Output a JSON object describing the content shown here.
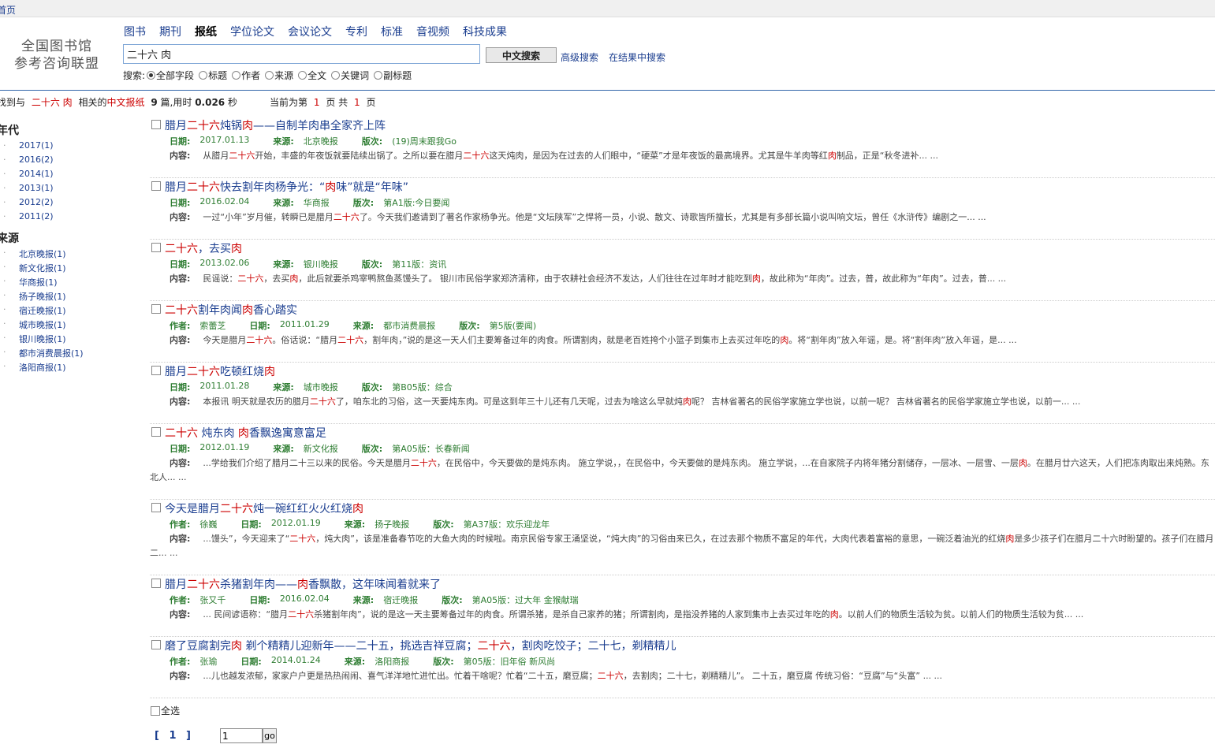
{
  "topbar": {
    "home": "首页"
  },
  "logo": {
    "line1": "全国图书馆",
    "line2": "参考咨询联盟"
  },
  "nav": [
    {
      "label": "图书",
      "active": false
    },
    {
      "label": "期刊",
      "active": false
    },
    {
      "label": "报纸",
      "active": true
    },
    {
      "label": "学位论文",
      "active": false
    },
    {
      "label": "会议论文",
      "active": false
    },
    {
      "label": "专利",
      "active": false
    },
    {
      "label": "标准",
      "active": false
    },
    {
      "label": "音视频",
      "active": false
    },
    {
      "label": "科技成果",
      "active": false
    }
  ],
  "search": {
    "value": "二十六 肉",
    "button": "中文搜索",
    "advanced": "高级搜索",
    "within": "在结果中搜索",
    "fields_label": "搜索:",
    "fields": [
      "全部字段",
      "标题",
      "作者",
      "来源",
      "全文",
      "关键词",
      "副标题"
    ],
    "selected_field": "全部字段"
  },
  "stats": {
    "prefix": "找到与",
    "query": "二十六 肉",
    "mid": "相关的",
    "type": "中文报纸",
    "count": "9",
    "unit": "篇,用时",
    "time": "0.026",
    "sec": "秒",
    "page_prefix": "当前为第",
    "current_page": "1",
    "page_mid": "页 共",
    "total_pages": "1",
    "page_suffix": "页"
  },
  "sidebar": {
    "year_heading": "年代",
    "years": [
      "2017(1)",
      "2016(2)",
      "2014(1)",
      "2013(1)",
      "2012(2)",
      "2011(2)"
    ],
    "source_heading": "来源",
    "sources": [
      "北京晚报(1)",
      "新文化报(1)",
      "华商报(1)",
      "扬子晚报(1)",
      "宿迁晚报(1)",
      "城市晚报(1)",
      "银川晚报(1)",
      "都市消费晨报(1)",
      "洛阳商报(1)"
    ]
  },
  "labels": {
    "author": "作者:",
    "date": "日期:",
    "source": "来源:",
    "edition": "版次:",
    "content": "内容:",
    "select_all": "全选",
    "go": "go",
    "pager": "[ 1 ]",
    "page_input": "1"
  },
  "results": [
    {
      "title": [
        [
          "腊月",
          0
        ],
        [
          "二十六",
          1
        ],
        [
          "炖锅",
          0
        ],
        [
          "肉",
          1
        ],
        [
          "——自制羊肉串全家齐上阵",
          0
        ]
      ],
      "author": "",
      "date": "2017.01.13",
      "source": "北京晚报",
      "edition": "(19)周末跟我Go",
      "content": [
        [
          "从腊月",
          0
        ],
        [
          "二十六",
          1
        ],
        [
          "开始，丰盛的年夜饭就要陆续出锅了。之所以要在腊月",
          0
        ],
        [
          "二十六",
          1
        ],
        [
          "这天炖肉，是因为在过去的人们眼中，“硬菜”才是年夜饭的最高境界。尤其是牛羊肉等红",
          0
        ],
        [
          "肉",
          1
        ],
        [
          "制品，正是“秋冬进补... ...",
          0
        ]
      ]
    },
    {
      "title": [
        [
          "腊月",
          0
        ],
        [
          "二十六",
          1
        ],
        [
          "快去割年肉杨争光：“",
          0
        ],
        [
          "肉",
          1
        ],
        [
          "味”就是“年味”",
          0
        ]
      ],
      "author": "",
      "date": "2016.02.04",
      "source": "华商报",
      "edition": "第A1版:今日要闻",
      "content": [
        [
          "一过“小年”岁月催，转瞬已是腊月",
          0
        ],
        [
          "二十六",
          1
        ],
        [
          "了。今天我们邀请到了著名作家杨争光。他是“文坛陕军”之悍将一员，小说、散文、诗歌皆所擅长，尤其是有多部长篇小说叫响文坛，曾任《水浒传》编剧之一... ...",
          0
        ]
      ]
    },
    {
      "title": [
        [
          "二十六",
          1
        ],
        [
          "，去买",
          0
        ],
        [
          "肉",
          1
        ]
      ],
      "author": "",
      "date": "2013.02.06",
      "source": "银川晚报",
      "edition": "第11版：资讯",
      "content": [
        [
          "民谣说：",
          0
        ],
        [
          "二十六",
          1
        ],
        [
          "，去买",
          0
        ],
        [
          "肉",
          1
        ],
        [
          "，此后就要杀鸡宰鸭熬鱼蒸馒头了。 银川市民俗学家郑济清称，由于农耕社会经济不发达，人们往往在过年时才能吃到",
          0
        ],
        [
          "肉",
          1
        ],
        [
          "，故此称为“年肉”。过去，普，故此称为“年肉”。过去，普... ...",
          0
        ]
      ]
    },
    {
      "title": [
        [
          "二十六",
          1
        ],
        [
          "割年肉闻",
          0
        ],
        [
          "肉",
          1
        ],
        [
          "香心踏实",
          0
        ]
      ],
      "author": "索蕾芝",
      "date": "2011.01.29",
      "source": "都市消费晨报",
      "edition": "第5版(要闻)",
      "content": [
        [
          "今天是腊月",
          0
        ],
        [
          "二十六",
          1
        ],
        [
          "。俗话说：“腊月",
          0
        ],
        [
          "二十六",
          1
        ],
        [
          "，割年肉，”说的是这一天人们主要筹备过年的肉食。所谓割肉，就是老百姓挎个小篮子到集市上去买过年吃的",
          0
        ],
        [
          "肉",
          1
        ],
        [
          "。将“割年肉”放入年谣，是。将“割年肉”放入年谣，是... ...",
          0
        ]
      ]
    },
    {
      "title": [
        [
          "腊月",
          0
        ],
        [
          "二十六",
          1
        ],
        [
          "吃顿红烧",
          0
        ],
        [
          "肉",
          1
        ]
      ],
      "author": "",
      "date": "2011.01.28",
      "source": "城市晚报",
      "edition": "第B05版：综合",
      "content": [
        [
          "本报讯 明天就是农历的腊月",
          0
        ],
        [
          "二十六",
          1
        ],
        [
          "了，咱东北的习俗，这一天要炖东肉。可是这到年三十儿还有几天呢，过去为啥这么早就炖",
          0
        ],
        [
          "肉",
          1
        ],
        [
          "呢？ 吉林省著名的民俗学家施立学也说，以前一呢？ 吉林省著名的民俗学家施立学也说，以前一... ...",
          0
        ]
      ]
    },
    {
      "title": [
        [
          "二十六",
          1
        ],
        [
          " 炖东肉 ",
          0
        ],
        [
          "肉",
          1
        ],
        [
          "香飘逸寓意富足",
          0
        ]
      ],
      "author": "",
      "date": "2012.01.19",
      "source": "新文化报",
      "edition": "第A05版：长春新闻",
      "content": [
        [
          "...学给我们介绍了腊月二十三以来的民俗。今天是腊月",
          0
        ],
        [
          "二十六",
          1
        ],
        [
          "，在民俗中，今天要做的是炖东肉。 施立学说，，在民俗中，今天要做的是炖东肉。 施立学说，...在自家院子内将年猪分割储存，一层冰、一层雪、一层",
          0
        ],
        [
          "肉",
          1
        ],
        [
          "。在腊月廿六这天，人们把冻肉取出来炖熟。东北人... ...",
          0
        ]
      ]
    },
    {
      "title": [
        [
          "今天是腊月",
          0
        ],
        [
          "二十六",
          1
        ],
        [
          "炖一碗红红火火红烧",
          0
        ],
        [
          "肉",
          1
        ]
      ],
      "author": "徐巍",
      "date": "2012.01.19",
      "source": "扬子晚报",
      "edition": "第A37版：欢乐迎龙年",
      "content": [
        [
          "...馒头”，今天迎来了“",
          0
        ],
        [
          "二十六",
          1
        ],
        [
          "，炖大肉”，该是准备春节吃的大鱼大肉的时候啦。南京民俗专家王涌坚说，“炖大肉”的习俗由来已久，在过去那个物质不富足的年代，大肉代表着富裕的意思，一碗泛着油光的红烧",
          0
        ],
        [
          "肉",
          1
        ],
        [
          "是多少孩子们在腊月二十六时盼望的。孩子们在腊月二... ...",
          0
        ]
      ]
    },
    {
      "title": [
        [
          "腊月",
          0
        ],
        [
          "二十六",
          1
        ],
        [
          "杀猪割年肉——",
          0
        ],
        [
          "肉",
          1
        ],
        [
          "香飘散，这年味闻着就来了",
          0
        ]
      ],
      "author": "张又千",
      "date": "2016.02.04",
      "source": "宿迁晚报",
      "edition": "第A05版：过大年 金猴献瑞",
      "content": [
        [
          "... 民间谚语称：“腊月",
          0
        ],
        [
          "二十六",
          1
        ],
        [
          "杀猪割年肉”，说的是这一天主要筹备过年的肉食。所谓杀猪，是杀自己家养的猪；所谓割肉，是指没养猪的人家到集市上去买过年吃的",
          0
        ],
        [
          "肉",
          1
        ],
        [
          "。以前人们的物质生活较为贫。以前人们的物质生活较为贫... ...",
          0
        ]
      ]
    },
    {
      "title": [
        [
          "磨了豆腐割完",
          0
        ],
        [
          "肉",
          1
        ],
        [
          " 剃个精精儿迎新年——二十五，挑选吉祥豆腐；",
          0
        ],
        [
          "二十六",
          1
        ],
        [
          "，割肉吃饺子；二十七，剃精精儿",
          0
        ]
      ],
      "author": "张瑜",
      "date": "2014.01.24",
      "source": "洛阳商报",
      "edition": "第05版：旧年俗 新风尚",
      "content": [
        [
          "...儿也越发浓郁，家家户户更是热热闹闹、喜气洋洋地忙进忙出。忙着干啥呢？忙着“二十五，磨豆腐；",
          0
        ],
        [
          "二十六",
          1
        ],
        [
          "，去割肉；二十七，剃精精儿”。 二十五，磨豆腐 传统习俗：“豆腐”与“头富” ... ...",
          0
        ]
      ]
    }
  ]
}
